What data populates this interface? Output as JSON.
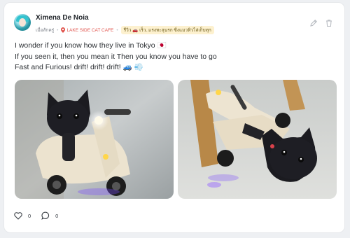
{
  "post": {
    "author": "Ximena De Noia",
    "time": "เมื่อสักครู่",
    "location": "LAKE SIDE CAT CAFE",
    "tag": "รีวิว 🚗 เร็ว..แรงทะลุนรก ซิ่งแมวหิวไล่เก็บทุก",
    "caption_lines": [
      "I wonder if you know how they live in Tokyo 🇯🇵",
      "If you seen it, then you mean it Then you know you have to go",
      "Fast and Furious! drift! drift! drift! 🚙 💨"
    ],
    "likes": "0",
    "comments": "0"
  },
  "colors": {
    "location": "#e0514a",
    "tag_bg": "#fdf1cf"
  },
  "icons": {
    "avatar": "profile-avatar",
    "location": "map-pin-icon",
    "edit": "pencil-icon",
    "delete": "trash-icon",
    "like": "heart-icon",
    "comment": "comment-icon"
  }
}
